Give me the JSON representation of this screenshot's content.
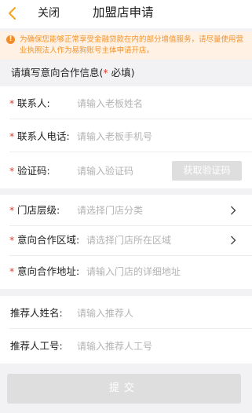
{
  "header": {
    "back_icon": "chevron-left-icon",
    "close_label": "关闭",
    "title": "加盟店申请",
    "accent_color": "#f5a623"
  },
  "notice": {
    "icon": "alert-icon",
    "icon_glyph": "!",
    "text": "为确保您能够正常享受金融贷款在内的部分增值服务，请尽量使用营业执照法人作为易狗账号主体申请开店。"
  },
  "section": {
    "title_prefix": "请填写意向合作信息(",
    "title_star": "*",
    "title_suffix": " 必填)"
  },
  "required_star": "*",
  "contact_fields": [
    {
      "label": "联系人:",
      "placeholder": "请输入老板姓名"
    },
    {
      "label": "联系人电话:",
      "placeholder": "请输入老板手机号"
    },
    {
      "label": "验证码:",
      "placeholder": "请输入验证码",
      "button": "获取验证码"
    }
  ],
  "store_fields": [
    {
      "label": "门店层级:",
      "placeholder": "请选择门店分类"
    },
    {
      "label": "意向合作区域:",
      "placeholder": "请选择门店所在区域"
    },
    {
      "label": "意向合作地址:",
      "placeholder": "请输入门店的详细地址"
    }
  ],
  "referrer_fields": [
    {
      "label": "推荐人姓名:",
      "placeholder": "请输入推荐人"
    },
    {
      "label": "推荐人工号:",
      "placeholder": "请输入推荐人工号"
    }
  ],
  "submit_label": "提交"
}
